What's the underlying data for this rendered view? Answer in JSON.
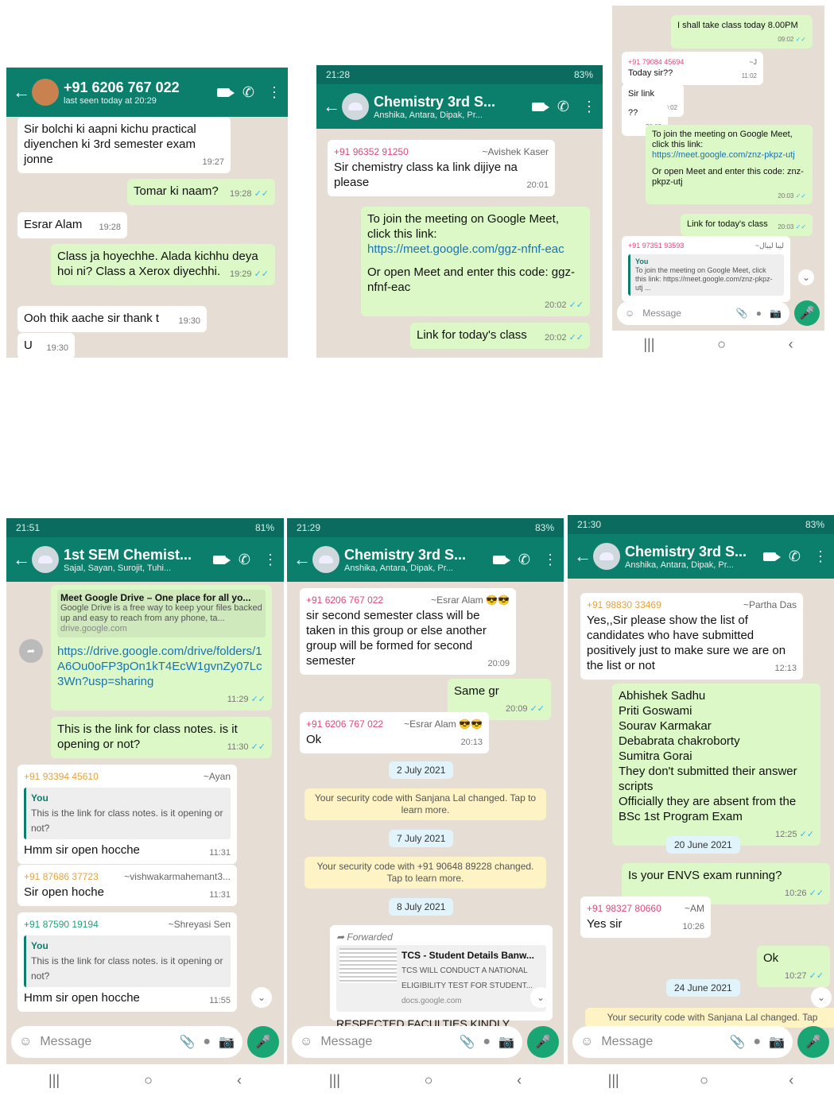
{
  "shot1": {
    "title": "+91 6206 767 022",
    "subtitle": "last seen today at 20:29",
    "messages": [
      {
        "text": "Sir bolchi ki aapni kichu practical diyenchen ki 3rd semester exam jonne",
        "time": "19:27"
      },
      {
        "text": "Tomar ki naam?",
        "time": "19:28"
      },
      {
        "text": "Esrar Alam",
        "time": "19:28"
      },
      {
        "text": "Class ja hoyechhe. Alada kichhu deya hoi ni? Class a Xerox  diyechhi.",
        "time": "19:29"
      },
      {
        "text": "Ooh thik aache sir thank t",
        "time": "19:30"
      },
      {
        "text": "U",
        "time": "19:30"
      }
    ]
  },
  "shot2": {
    "status_time": "21:28",
    "status_right": "83%",
    "title": "Chemistry  3rd S...",
    "subtitle": "Anshika, Antara, Dipak, Pr...",
    "m1_sender": "+91 96352 91250",
    "m1_alias": "~Avishek Kaser",
    "m1_text": "Sir chemistry class ka link dijiye na please",
    "m1_time": "20:01",
    "m2_text1": "To join the meeting on Google Meet, click this link:",
    "m2_link": "https://meet.google.com/ggz-nfnf-eac",
    "m2_text2": "Or open Meet and enter this code: ggz-nfnf-eac",
    "m2_time": "20:02",
    "m3_text": "Link for today's class",
    "m3_time": "20:02"
  },
  "shot3": {
    "m0_text": "I shall take class today  8.00PM",
    "m0_time": "09:02",
    "m1_sender": "+91 79084 45694",
    "m1_alias": "~J",
    "m1_text": "Today sir??",
    "m1_time": "11:02",
    "m2_text": "Sir link",
    "m2_time": "20:02",
    "m3_text": "??",
    "m3_time": "20:02",
    "m4_text1": "To join the meeting on Google Meet, click this link:",
    "m4_link": "https://meet.google.com/znz-pkpz-utj",
    "m4_text2": "Or open Meet and enter this code: znz-pkpz-utj",
    "m4_time": "20:03",
    "m5_text": "Link for today's class",
    "m5_time": "20:03",
    "m6_sender": "+91 97351 93593",
    "m6_alias": "~ليبا ليبال",
    "m6_quote_author": "You",
    "m6_quote": "To join the meeting on Google Meet, click this link: https://meet.google.com/znz-pkpz-utj ...",
    "input_placeholder": "Message"
  },
  "shot4": {
    "status_time": "21:51",
    "status_right": "81%",
    "title": "1st SEM Chemist...",
    "subtitle": "Sajal, Sayan, Surojit, Tuhi...",
    "preview_title": "Meet Google Drive – One place for all yo...",
    "preview_desc": "Google Drive is a free way to keep your files backed up and easy to reach from any phone, ta...",
    "preview_domain": "drive.google.com",
    "link": "https://drive.google.com/drive/folders/1A6Ou0oFP3pOn1kT4EcW1gvnZy07Lc3Wn?usp=sharing",
    "link_time": "11:29",
    "m2_text": "This is the link  for class notes. is it opening or not?",
    "m2_time": "11:30",
    "m3_sender": "+91 93394 45610",
    "m3_alias": "~Ayan",
    "m3_quote_author": "You",
    "m3_quote": "This is the link  for class notes. is it opening or not?",
    "m3_text": "Hmm sir open hocche",
    "m3_time": "11:31",
    "m4_sender": "+91 87686 37723",
    "m4_alias": "~vishwakarmahemant3...",
    "m4_text": "Sir open hoche",
    "m4_time": "11:31",
    "m5_sender": "+91 87590 19194",
    "m5_alias": "~Shreyasi Sen",
    "m5_quote_author": "You",
    "m5_quote": "This is the link  for class notes. is it opening or not?",
    "m5_text": "Hmm sir open hocche",
    "m5_time": "11:55",
    "input_placeholder": "Message"
  },
  "shot5": {
    "status_time": "21:29",
    "status_right": "83%",
    "title": "Chemistry  3rd S...",
    "subtitle": "Anshika, Antara, Dipak, Pr...",
    "m1_sender": "+91 6206 767 022",
    "m1_alias": "~Esrar Alam 😎😎",
    "m1_text": "sir second semester class will be taken in this group or else another group will be formed for second semester",
    "m1_time": "20:09",
    "m2_text": "Same gr",
    "m2_time": "20:09",
    "m3_sender": "+91 6206 767 022",
    "m3_alias": "~Esrar Alam 😎😎",
    "m3_text": "Ok",
    "m3_time": "20:13",
    "date1": "2 July 2021",
    "sys1": "Your security code with Sanjana Lal changed. Tap to learn more.",
    "date2": "7 July 2021",
    "sys2": "Your security code with +91 90648 89228 changed. Tap to learn more.",
    "date3": "8 July 2021",
    "fwd_label": "Forwarded",
    "doc_title": "TCS - Student Details Banw...",
    "doc_desc": "TCS WILL CONDUCT A NATIONAL ELIGIBILITY TEST FOR STUDENT...",
    "doc_domain": "docs.google.com",
    "doc_footer": "RESPECTED FACULTIES  KINDLY",
    "input_placeholder": "Message"
  },
  "shot6": {
    "status_time": "21:30",
    "status_right": "83%",
    "title": "Chemistry  3rd S...",
    "subtitle": "Anshika, Antara, Dipak, Pr...",
    "m1_sender": "+91 98830 33469",
    "m1_alias": "~Partha Das",
    "m1_text": "Yes,,Sir please show the list of candidates who have submitted positively just to make sure we are on the list or not",
    "m1_time": "12:13",
    "m2_lines": [
      "Abhishek Sadhu",
      "Priti Goswami",
      "Sourav Karmakar",
      "Debabrata chakroborty",
      "Sumitra Gorai",
      "They don't submitted their answer scripts",
      "Officially they are absent from the BSc 1st Program Exam"
    ],
    "m2_time": "12:25",
    "date1": "20 June 2021",
    "m3_text": "Is your ENVS exam running?",
    "m3_time": "10:26",
    "m4_sender": "+91 98327 80660",
    "m4_alias": "~AM",
    "m4_text": "Yes sir",
    "m4_time": "10:26",
    "m5_text": "Ok",
    "m5_time": "10:27",
    "date2": "24 June 2021",
    "sys1": "Your security code with Sanjana Lal changed. Tap",
    "input_placeholder": "Message"
  }
}
